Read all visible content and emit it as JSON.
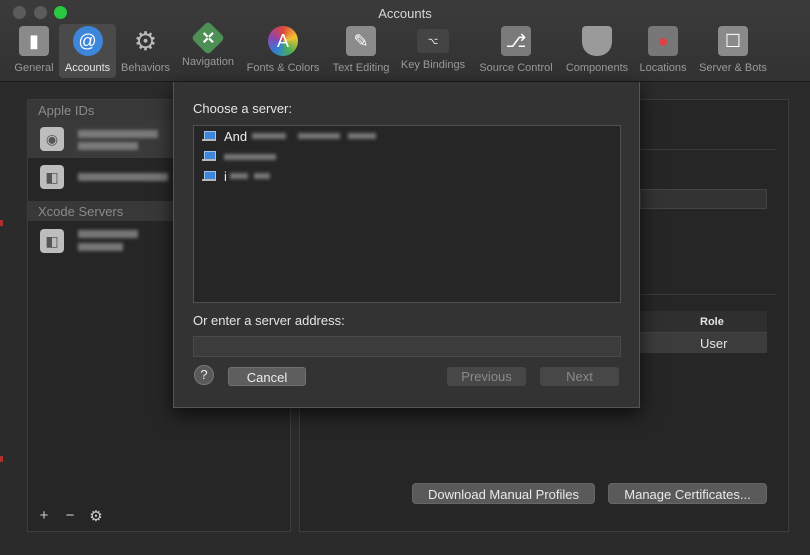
{
  "window": {
    "title": "Accounts"
  },
  "toolbar": {
    "items": [
      {
        "label": "General",
        "icon": "switch-icon"
      },
      {
        "label": "Accounts",
        "icon": "at-icon"
      },
      {
        "label": "Behaviors",
        "icon": "gear-icon"
      },
      {
        "label": "Navigation",
        "icon": "compass-icon"
      },
      {
        "label": "Fonts & Colors",
        "icon": "palette-icon"
      },
      {
        "label": "Text Editing",
        "icon": "pencil-icon"
      },
      {
        "label": "Key Bindings",
        "icon": "keyboard-icon"
      },
      {
        "label": "Source Control",
        "icon": "source-control-icon"
      },
      {
        "label": "Components",
        "icon": "shield-icon"
      },
      {
        "label": "Locations",
        "icon": "joystick-icon"
      },
      {
        "label": "Server & Bots",
        "icon": "robot-icon"
      }
    ],
    "selected": "Accounts"
  },
  "sidebar": {
    "apple_ids_header": "Apple IDs",
    "xcode_servers_header": "Xcode Servers",
    "footer": {
      "add": "+",
      "remove": "−",
      "settings": "⚙"
    }
  },
  "detail": {
    "role_header": "Role",
    "role_value": "User",
    "download_profiles_label": "Download Manual Profiles",
    "manage_certificates_label": "Manage Certificates..."
  },
  "sheet": {
    "choose_label": "Choose a server:",
    "servers": [
      "And",
      "",
      "i"
    ],
    "address_label": "Or enter a server address:",
    "address_value": "",
    "help_label": "?",
    "cancel_label": "Cancel",
    "previous_label": "Previous",
    "next_label": "Next"
  },
  "colors": {
    "accent": "#3d86d9",
    "close_green": "#28c840"
  }
}
